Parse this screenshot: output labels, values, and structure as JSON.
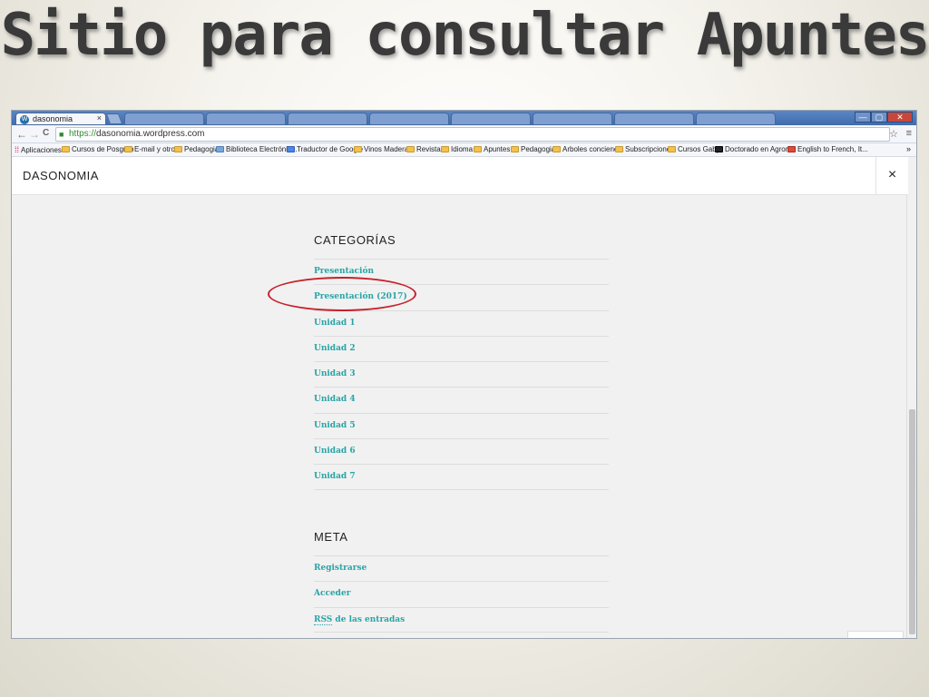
{
  "slide": {
    "title": "Sitio para consultar Apuntes"
  },
  "browser": {
    "active_tab": {
      "title": "dasonomia",
      "favicon": "wordpress-icon",
      "close": "×"
    },
    "background_tabs": 8,
    "window_buttons": {
      "minimize": "—",
      "maximize": "▢",
      "close": "✕"
    },
    "nav": {
      "back": "←",
      "forward": "→",
      "reload": "C"
    },
    "address": {
      "scheme": "https://",
      "rest": "dasonomia.wordpress.com",
      "lock_icon": "lock-icon"
    },
    "toolbar_right": {
      "star": "☆",
      "menu": "≡"
    },
    "bookmarks": [
      "Aplicaciones",
      "Cursos de Posgrdo",
      "E-mail y otros",
      "Pedagogia",
      "Biblioteca Electrónic...",
      "Traductor de Google",
      "Vinos Maderas",
      "Revistas",
      "Idioma",
      "Apuntes",
      "Pedagogia",
      "Arboles conciencia",
      "Subscripciones",
      "Cursos Gaby",
      "Doctorado en Agron...",
      "English to French, It..."
    ],
    "bookmarks_more": "»"
  },
  "page": {
    "site_title": "DASONOMIA",
    "close_label": "×",
    "categories": {
      "heading": "CATEGORÍAS",
      "items": [
        "Presentación",
        "Presentación (2017)",
        "Unidad 1",
        "Unidad 2",
        "Unidad 3",
        "Unidad 4",
        "Unidad 5",
        "Unidad 6",
        "Unidad 7"
      ]
    },
    "meta": {
      "heading": "META",
      "items": [
        "Registrarse",
        "Acceder"
      ],
      "rss_abbr": "RSS",
      "rss_rest": " de las entradas"
    }
  },
  "colors": {
    "link": "#2aa4a6",
    "annotation": "#c8202a"
  }
}
